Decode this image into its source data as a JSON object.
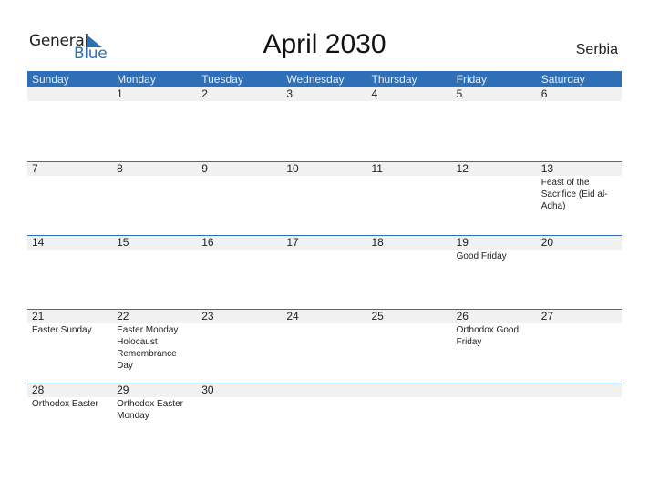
{
  "logo": {
    "general": "General",
    "blue": "Blue",
    "icon": "triangle-flag-icon",
    "accent": "#2e6fb5"
  },
  "title": "April 2030",
  "country": "Serbia",
  "header_color": "#2e6fb5",
  "days": [
    "Sunday",
    "Monday",
    "Tuesday",
    "Wednesday",
    "Thursday",
    "Friday",
    "Saturday"
  ],
  "weeks": [
    {
      "nums": [
        "",
        "1",
        "2",
        "3",
        "4",
        "5",
        "6"
      ],
      "events": [
        "",
        "",
        "",
        "",
        "",
        "",
        ""
      ]
    },
    {
      "nums": [
        "7",
        "8",
        "9",
        "10",
        "11",
        "12",
        "13"
      ],
      "events": [
        "",
        "",
        "",
        "",
        "",
        "",
        "Feast of the Sacrifice (Eid al-Adha)"
      ]
    },
    {
      "nums": [
        "14",
        "15",
        "16",
        "17",
        "18",
        "19",
        "20"
      ],
      "events": [
        "",
        "",
        "",
        "",
        "",
        "Good Friday",
        ""
      ]
    },
    {
      "nums": [
        "21",
        "22",
        "23",
        "24",
        "25",
        "26",
        "27"
      ],
      "events": [
        "Easter Sunday",
        "Easter Monday\n  Holocaust Remembrance Day",
        "",
        "",
        "",
        "Orthodox Good Friday",
        ""
      ]
    },
    {
      "nums": [
        "28",
        "29",
        "30",
        "",
        "",
        "",
        ""
      ],
      "events": [
        "Orthodox Easter",
        "Orthodox Easter Monday",
        "",
        "",
        "",
        "",
        ""
      ]
    }
  ]
}
